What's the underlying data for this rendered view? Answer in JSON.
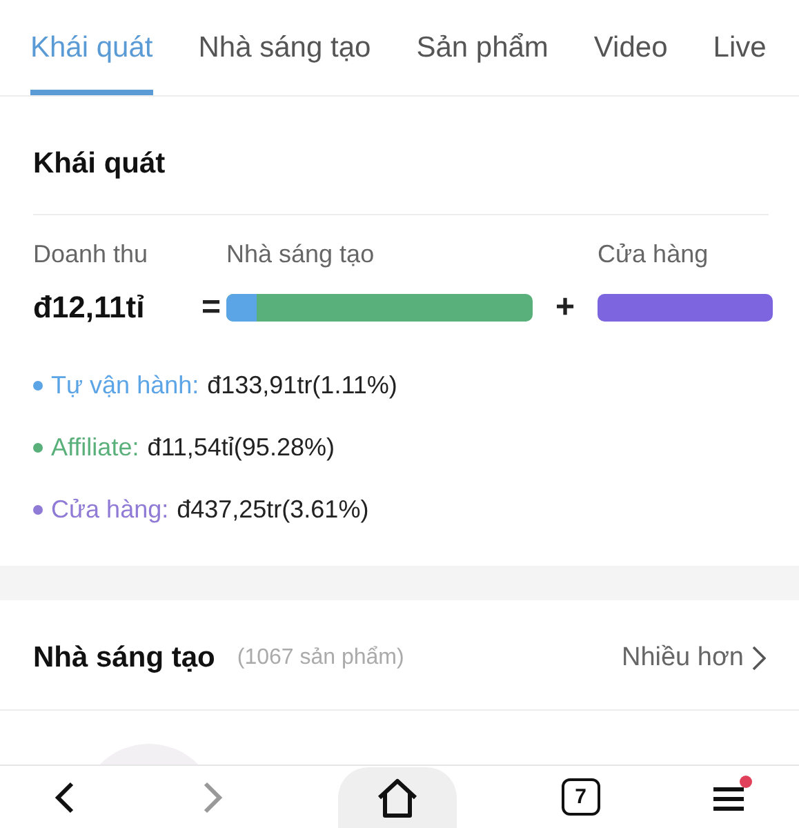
{
  "tabs": [
    {
      "label": "Khái quát",
      "selected": true
    },
    {
      "label": "Nhà sáng tạo",
      "selected": false
    },
    {
      "label": "Sản phẩm",
      "selected": false
    },
    {
      "label": "Video",
      "selected": false
    },
    {
      "label": "Live",
      "selected": false
    }
  ],
  "overview": {
    "title": "Khái quát",
    "revenue_label": "Doanh thu",
    "revenue_value": "đ12,11tỉ",
    "equals": "=",
    "plus": "+",
    "creator_label": "Nhà sáng tạo",
    "store_label": "Cửa hàng",
    "creator_bar": {
      "color": "#5ab07a",
      "fill": {
        "color": "#5ba4e6",
        "level": 0.1
      }
    },
    "store_bar": {
      "color": "#7d65e0"
    },
    "legend": [
      {
        "label": "Tự vận hành:",
        "value": "đ133,91tr(1.11%)",
        "color": "#5ba4e6"
      },
      {
        "label": "Affiliate:",
        "value": "đ11,54tỉ(95.28%)",
        "color": "#5ab07a"
      },
      {
        "label": "Cửa hàng:",
        "value": "đ437,25tr(3.61%)",
        "color": "#8f7ad6"
      }
    ]
  },
  "creators": {
    "title": "Nhà sáng tạo",
    "count": "(1067 sản phẩm)",
    "more": "Nhiều hơn"
  },
  "nav": [
    {
      "kind": "back",
      "disabled": false,
      "selected": false
    },
    {
      "kind": "forward",
      "disabled": true,
      "selected": false
    },
    {
      "kind": "home",
      "selected": true
    },
    {
      "kind": "tabs",
      "count": "7",
      "selected": false
    },
    {
      "kind": "menu",
      "badge": true,
      "selected": false
    }
  ]
}
